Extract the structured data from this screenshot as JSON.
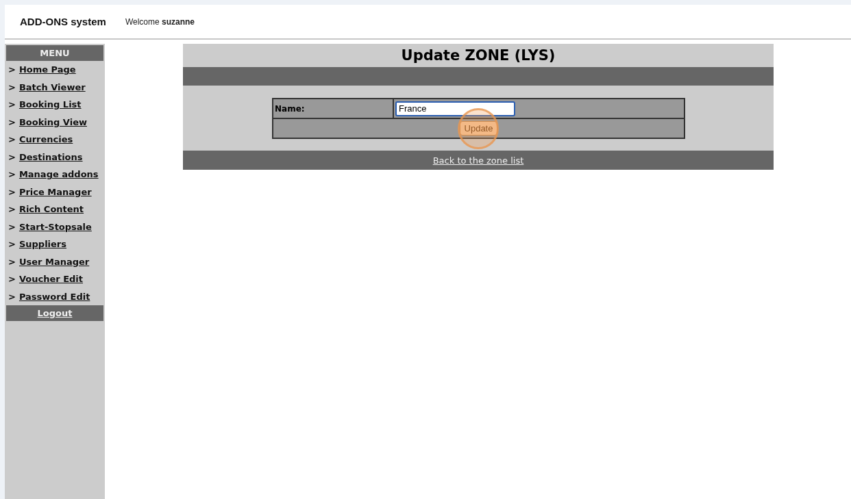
{
  "header": {
    "app_title": "ADD-ONS system",
    "welcome": "Welcome **suzanne**"
  },
  "sidebar": {
    "title": "MENU",
    "items": [
      {
        "marker": ">",
        "label": "Home Page"
      },
      {
        "marker": ">",
        "label": "Batch Viewer"
      },
      {
        "marker": ">",
        "label": "Booking List"
      },
      {
        "marker": ">",
        "label": "Booking View"
      },
      {
        "marker": ">",
        "label": "Currencies"
      },
      {
        "marker": ">",
        "label": "Destinations"
      },
      {
        "marker": ">",
        "label": "Manage addons"
      },
      {
        "marker": ">",
        "label": "Price Manager"
      },
      {
        "marker": ">",
        "label": "Rich Content"
      },
      {
        "marker": ">",
        "label": "Start-Stopsale"
      },
      {
        "marker": ">",
        "label": "Suppliers"
      },
      {
        "marker": ">",
        "label": "User Manager"
      },
      {
        "marker": ">",
        "label": "Voucher Edit"
      },
      {
        "marker": ">",
        "label": "Password Edit"
      }
    ],
    "logout": "Logout"
  },
  "main": {
    "title": "Update ZONE (LYS)",
    "form": {
      "name_label": "Name:",
      "name_value": "France",
      "submit": "Update",
      "click_highlight": true
    },
    "back_link": "Back to the zone list"
  }
}
